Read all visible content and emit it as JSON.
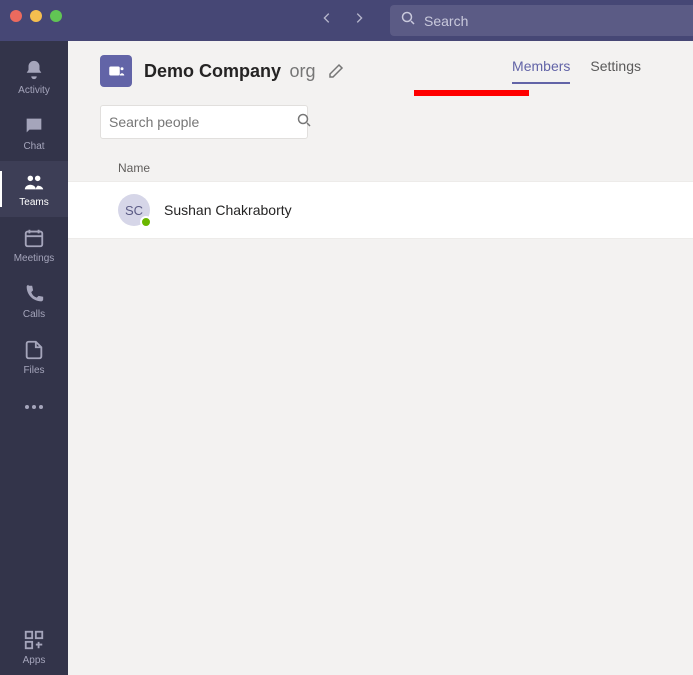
{
  "search": {
    "placeholder": "Search"
  },
  "rail": {
    "activity": "Activity",
    "chat": "Chat",
    "teams": "Teams",
    "meetings": "Meetings",
    "calls": "Calls",
    "files": "Files",
    "apps": "Apps"
  },
  "team": {
    "name": "Demo Company",
    "suffix": "org"
  },
  "tabs": {
    "members": "Members",
    "settings": "Settings"
  },
  "filter": {
    "placeholder": "Search people"
  },
  "columns": {
    "name": "Name"
  },
  "members": [
    {
      "initials": "SC",
      "name": "Sushan Chakraborty"
    }
  ]
}
